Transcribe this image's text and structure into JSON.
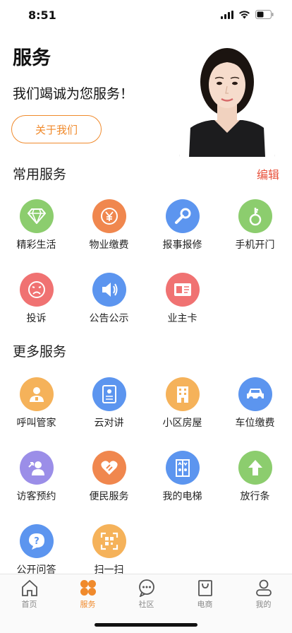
{
  "status_bar": {
    "time": "8:51"
  },
  "hero": {
    "title": "服务",
    "subtitle": "我们竭诚为您服务！",
    "about_button": "关于我们"
  },
  "common": {
    "title": "常用服务",
    "edit": "编辑",
    "items": [
      {
        "label": "精彩生活",
        "icon": "diamond-icon",
        "color": "#8ccd6e"
      },
      {
        "label": "物业缴费",
        "icon": "yen-icon",
        "color": "#f0874e"
      },
      {
        "label": "报事报修",
        "icon": "wrench-icon",
        "color": "#5c95ef"
      },
      {
        "label": "手机开门",
        "icon": "key-icon",
        "color": "#8ccd6e"
      },
      {
        "label": "投诉",
        "icon": "sad-face-icon",
        "color": "#f07272"
      },
      {
        "label": "公告公示",
        "icon": "speaker-icon",
        "color": "#5c95ef"
      },
      {
        "label": "业主卡",
        "icon": "card-icon",
        "color": "#f07272"
      }
    ]
  },
  "more": {
    "title": "更多服务",
    "items": [
      {
        "label": "呼叫管家",
        "icon": "butler-icon",
        "color": "#f5b25a"
      },
      {
        "label": "云对讲",
        "icon": "intercom-icon",
        "color": "#5c95ef"
      },
      {
        "label": "小区房屋",
        "icon": "building-icon",
        "color": "#f5b25a"
      },
      {
        "label": "车位缴费",
        "icon": "car-icon",
        "color": "#5c95ef"
      },
      {
        "label": "访客预约",
        "icon": "visitor-icon",
        "color": "#9b8ee8"
      },
      {
        "label": "便民服务",
        "icon": "heart-hand-icon",
        "color": "#f0874e"
      },
      {
        "label": "我的电梯",
        "icon": "elevator-icon",
        "color": "#5c95ef"
      },
      {
        "label": "放行条",
        "icon": "arrow-up-icon",
        "color": "#8ccd6e"
      },
      {
        "label": "公开问答",
        "icon": "question-icon",
        "color": "#5c95ef"
      },
      {
        "label": "扫一扫",
        "icon": "scan-icon",
        "color": "#f5b25a"
      }
    ]
  },
  "tabbar": {
    "items": [
      {
        "label": "首页",
        "icon": "home-icon"
      },
      {
        "label": "服务",
        "icon": "service-icon",
        "active": true
      },
      {
        "label": "社区",
        "icon": "chat-icon"
      },
      {
        "label": "电商",
        "icon": "shopping-bag-icon"
      },
      {
        "label": "我的",
        "icon": "user-icon"
      }
    ],
    "active_color": "#f08a2c"
  }
}
